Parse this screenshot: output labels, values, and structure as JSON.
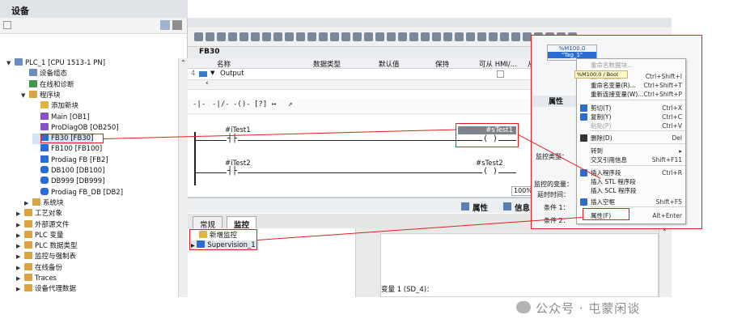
{
  "project_tree": {
    "title": "设备",
    "items": [
      {
        "label": "PLC_1 [CPU 1513-1 PN]",
        "icon": "plc-icon",
        "expanded": true
      },
      {
        "label": "设备组态",
        "icon": "device-config-icon"
      },
      {
        "label": "在线和诊断",
        "icon": "online-diagnostics-icon"
      },
      {
        "label": "程序块",
        "icon": "folder-icon",
        "expanded": true
      },
      {
        "label": "添加新块",
        "icon": "add-block-icon"
      },
      {
        "label": "Main [OB1]",
        "icon": "ob-icon"
      },
      {
        "label": "ProDiagOB [OB250]",
        "icon": "ob-icon"
      },
      {
        "label": "FB30 [FB30]",
        "icon": "fb-icon",
        "selected": true
      },
      {
        "label": "FB100 [FB100]",
        "icon": "fb-icon"
      },
      {
        "label": "Prodiag FB [FB2]",
        "icon": "fb-icon"
      },
      {
        "label": "DB100 [DB100]",
        "icon": "db-icon"
      },
      {
        "label": "DB999 [DB999]",
        "icon": "db-icon"
      },
      {
        "label": "Prodiag FB_DB [DB2]",
        "icon": "db-icon"
      },
      {
        "label": "系统块",
        "icon": "folder-icon"
      },
      {
        "label": "工艺对象",
        "icon": "folder-icon"
      },
      {
        "label": "外部源文件",
        "icon": "folder-icon"
      },
      {
        "label": "PLC 变量",
        "icon": "folder-icon"
      },
      {
        "label": "PLC 数据类型",
        "icon": "folder-icon"
      },
      {
        "label": "监控与强制表",
        "icon": "folder-icon"
      },
      {
        "label": "在线备份",
        "icon": "folder-icon"
      },
      {
        "label": "Traces",
        "icon": "folder-icon"
      },
      {
        "label": "设备代理数据",
        "icon": "folder-icon"
      }
    ]
  },
  "editor": {
    "block_name": "FB30",
    "interface_columns": [
      "名称",
      "数据类型",
      "默认值",
      "保持",
      "可从 HMI/...",
      "从"
    ],
    "interface_row": {
      "index": "4",
      "label": "Output"
    },
    "networks": [
      {
        "contact": "#iTest1",
        "coil": "#sTest1"
      },
      {
        "contact": "#iTest2",
        "coil": "#sTest2"
      }
    ],
    "zoom": "100%"
  },
  "inspector": {
    "properties_tab": "属性",
    "info_tab": "信息",
    "tabs": [
      "常规",
      "监控"
    ],
    "active_tab": "监控",
    "supervision_items": [
      "新增监控",
      "Supervision_1"
    ],
    "variable_label": "变量 1 (SD_4)："
  },
  "popup": {
    "tag_box": "%M100.0",
    "tag_box_sub": "\"Tag_1\"",
    "tooltip": "%M100.0 / Bool",
    "prop_label": "属性",
    "side_labels": [
      "监控类型：",
      "监控的变量：",
      "延时时间：",
      "条件 1：",
      "条件 2："
    ],
    "menu_items": [
      {
        "label": "重命名数据块...",
        "shortcut": "",
        "disabled": true
      },
      {
        "label": "重命名变量...",
        "shortcut": "Ctrl+Shift+I",
        "disabled": true
      },
      {
        "label": "重命名变量(R)...",
        "shortcut": "Ctrl+Shift+T",
        "disabled": false
      },
      {
        "label": "重新连接变量(W)...",
        "shortcut": "Ctrl+Shift+P",
        "disabled": false
      },
      {
        "label": "剪切(T)",
        "shortcut": "Ctrl+X",
        "disabled": false
      },
      {
        "label": "复制(Y)",
        "shortcut": "Ctrl+C",
        "disabled": false
      },
      {
        "label": "粘贴(P)",
        "shortcut": "Ctrl+V",
        "disabled": true
      },
      {
        "label": "删除(D)",
        "shortcut": "Del",
        "disabled": false
      },
      {
        "label": "转到",
        "shortcut": "▸",
        "disabled": false
      },
      {
        "label": "交叉引用信息",
        "shortcut": "Shift+F11",
        "disabled": false
      },
      {
        "label": "插入程序段",
        "shortcut": "Ctrl+R",
        "disabled": false
      },
      {
        "label": "插入 STL 程序段",
        "shortcut": "",
        "disabled": false
      },
      {
        "label": "插入 SCL 程序段",
        "shortcut": "",
        "disabled": false
      },
      {
        "label": "插入空框",
        "shortcut": "Shift+F5",
        "disabled": false
      },
      {
        "label": "属性(F)",
        "shortcut": "Alt+Enter",
        "disabled": false
      }
    ]
  },
  "watermark": "公众号 · 屯蒙闲谈",
  "colors": {
    "annotation": "#e02020",
    "selection": "#7d838a",
    "accent": "#2b6cd4"
  }
}
